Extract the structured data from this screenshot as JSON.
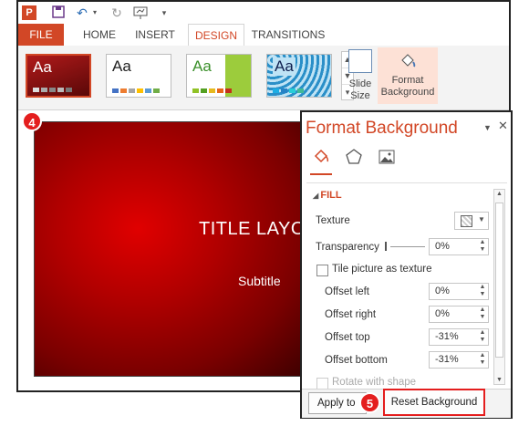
{
  "qat": {
    "icons": [
      "powerpoint-logo-icon",
      "save-icon",
      "undo-icon",
      "redo-icon",
      "presentation-icon",
      "customize-icon"
    ],
    "logo_text": "P"
  },
  "tabs": [
    {
      "label": "FILE"
    },
    {
      "label": "HOME"
    },
    {
      "label": "INSERT"
    },
    {
      "label": "DESIGN"
    },
    {
      "label": "TRANSITIONS"
    }
  ],
  "ribbon": {
    "themes": [
      {
        "label": "Aa",
        "bg": "#8a1010",
        "fg": "#ffffff"
      },
      {
        "label": "Aa",
        "bg": "#ffffff",
        "fg": "#222222"
      },
      {
        "label": "Aa",
        "bg": "#ffffff",
        "fg": "#3a8f2a"
      },
      {
        "label": "Aa",
        "bg": "#2a8fc8",
        "fg": "#102050"
      }
    ],
    "slide_size_label": "Slide Size",
    "format_background_label": "Format Background"
  },
  "slide": {
    "title": "TITLE LAYOUT",
    "subtitle": "Subtitle"
  },
  "badges": {
    "step4": "4",
    "step5": "5"
  },
  "pane": {
    "title": "Format Background",
    "fill_header": "FILL",
    "texture_label": "Texture",
    "transparency_label": "Transparency",
    "transparency_value": "0%",
    "tile_label": "Tile picture as texture",
    "offset_left_label": "Offset left",
    "offset_left_value": "0%",
    "offset_right_label": "Offset right",
    "offset_right_value": "0%",
    "offset_top_label": "Offset top",
    "offset_top_value": "-31%",
    "offset_bottom_label": "Offset bottom",
    "offset_bottom_value": "-31%",
    "rotate_label": "Rotate with shape",
    "apply_label": "Apply to",
    "reset_label": "Reset Background"
  },
  "colors": {
    "accent": "#d24726",
    "badge": "#e41e1e"
  }
}
